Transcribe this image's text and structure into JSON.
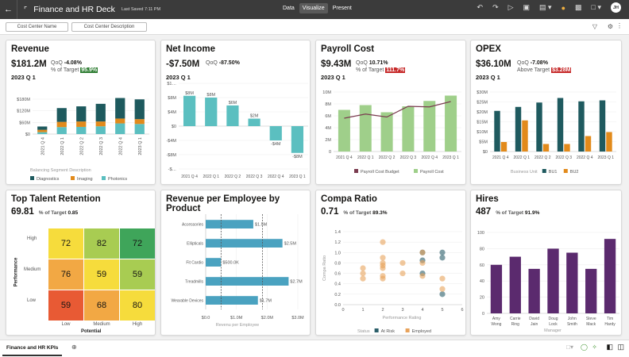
{
  "app": {
    "title": "Finance and HR Deck",
    "last_saved": "Last Saved 7:11 PM",
    "modes": [
      "Data",
      "Visualize",
      "Present"
    ],
    "active_mode": "Visualize",
    "avatar": "JH"
  },
  "filters": [
    "Cost Center Name",
    "Cost Center Description"
  ],
  "tabs": {
    "active": "Finance and HR KPIs"
  },
  "colors": {
    "diagnostics": "#1e5a5e",
    "imaging": "#e28a1b",
    "photonics": "#5bbfc0",
    "net_income": "#5bbfc0",
    "payroll": "#9fcf8a",
    "budget": "#7a3b4f",
    "bu1": "#1f5a5f",
    "bu2": "#e28a1b",
    "rev_emp": "#4aa2c0",
    "hires": "#5b2a6e",
    "at_risk": "#2c5f6a",
    "employed": "#e8a35c",
    "good": "#2e7d32",
    "bad": "#c62828"
  },
  "cards": {
    "revenue": {
      "title": "Revenue",
      "value": "$181.2M",
      "qoq_label": "QoQ",
      "qoq": "-4.08%",
      "target_label": "% of Target",
      "target": "95.9%",
      "period": "2023 Q 1"
    },
    "net_income": {
      "title": "Net Income",
      "value": "-$7.50M",
      "qoq_label": "QoQ",
      "qoq": "-87.50%",
      "period": "2023 Q 1"
    },
    "payroll": {
      "title": "Payroll Cost",
      "value": "$9.43M",
      "qoq_label": "QoQ",
      "qoq": "10.71%",
      "target_label": "% of Target",
      "target": "111.7%",
      "period": "2023 Q 1"
    },
    "opex": {
      "title": "OPEX",
      "value": "$36.10M",
      "qoq_label": "QoQ",
      "qoq": "-7.08%",
      "target_label": "Above Target",
      "target": "$3.28M",
      "period": "2023 Q 1"
    },
    "talent": {
      "title": "Top Talent Retention",
      "value": "69.81",
      "target_label": "% of Target",
      "target": "0.85"
    },
    "rev_emp": {
      "title": "Revenue per Employee by Product"
    },
    "compa": {
      "title": "Compa Ratio",
      "value": "0.71",
      "target_label": "% of Target",
      "target": "89.3%"
    },
    "hires": {
      "title": "Hires",
      "value": "487",
      "target_label": "% of Target",
      "target": "91.9%"
    }
  },
  "chart_data": [
    {
      "id": "revenue",
      "type": "bar",
      "stacked": true,
      "categories": [
        "2021 Q 4",
        "2022 Q 1",
        "2022 Q 2",
        "2022 Q 3",
        "2022 Q 4",
        "2023 Q 1"
      ],
      "series": [
        {
          "name": "Photonics",
          "values": [
            10,
            36,
            37,
            40,
            55,
            52
          ]
        },
        {
          "name": "Imaging",
          "values": [
            12,
            27,
            28,
            25,
            25,
            25
          ]
        },
        {
          "name": "Diagnostics",
          "values": [
            17,
            71,
            78,
            91,
            106,
            102
          ]
        }
      ],
      "ylim": [
        0,
        180
      ],
      "yticks": [
        "$0",
        "$60M",
        "$120M",
        "$180M"
      ],
      "legend_title": "Balancing Segment Description",
      "legend": "bottom"
    },
    {
      "id": "net_income",
      "type": "bar",
      "categories": [
        "2021 Q 4",
        "2022 Q 1",
        "2022 Q 2",
        "2022 Q 3",
        "2022 Q 4",
        "2023 Q 1"
      ],
      "values": [
        8.5,
        8,
        5.8,
        2.1,
        -4,
        -7.5
      ],
      "labels": [
        "$8M",
        "$8M",
        "$6M",
        "$2M",
        "-$4M",
        "-$8M"
      ],
      "ylim": [
        -12,
        12
      ],
      "yticks": [
        "-$…",
        "-$8M",
        "-$4M",
        "$0",
        "$4M",
        "$8M",
        "$1…"
      ]
    },
    {
      "id": "payroll",
      "type": "bar+line",
      "categories": [
        "2021 Q 4",
        "2022 Q 1",
        "2022 Q 2",
        "2022 Q 3",
        "2022 Q 4",
        "2023 Q 1"
      ],
      "series": [
        {
          "name": "Payroll Cost Budget",
          "type": "line",
          "values": [
            5.6,
            6.3,
            5.8,
            7.6,
            7.5,
            8.4
          ]
        },
        {
          "name": "Payroll Cost",
          "type": "bar",
          "values": [
            7,
            7.8,
            6.6,
            7.6,
            8.5,
            9.4
          ]
        }
      ],
      "ylim": [
        0,
        10
      ],
      "yticks": [
        "0",
        "2M",
        "4M",
        "6M",
        "8M",
        "10M"
      ],
      "legend": "bottom"
    },
    {
      "id": "opex",
      "type": "bar",
      "categories": [
        "2021 Q 4",
        "2022 Q 1",
        "2022 Q 2",
        "2022 Q 3",
        "2022 Q 4",
        "2023 Q 1"
      ],
      "series": [
        {
          "name": "BU1",
          "values": [
            20.5,
            22.5,
            24.7,
            27,
            25.3,
            25.8
          ]
        },
        {
          "name": "BU2",
          "values": [
            4.8,
            15.7,
            3.8,
            3.8,
            7.8,
            9.8
          ]
        }
      ],
      "ylim": [
        0,
        30
      ],
      "yticks": [
        "$0",
        "$5M",
        "$10M",
        "$15M",
        "$20M",
        "$25M",
        "$30M"
      ],
      "legend_title": "Business Unit",
      "legend": "bottom"
    },
    {
      "id": "talent",
      "type": "heatmap",
      "rows": [
        "High",
        "Medium",
        "Low"
      ],
      "cols": [
        "Low",
        "Medium",
        "High"
      ],
      "values": [
        [
          72,
          82,
          72
        ],
        [
          76,
          59,
          59
        ],
        [
          59,
          68,
          80
        ]
      ],
      "colors": [
        [
          "#f6dc3c",
          "#a8cc52",
          "#3fa55a"
        ],
        [
          "#f2a844",
          "#f6dc3c",
          "#a8cc52"
        ],
        [
          "#e85a34",
          "#f2a844",
          "#f6dc3c"
        ]
      ],
      "ylabel": "Performance",
      "xlabel": "Potential"
    },
    {
      "id": "rev_emp",
      "type": "bar",
      "orientation": "horizontal",
      "categories": [
        "Accessories",
        "Ellipticals",
        "Fit Cardio",
        "Treadmills",
        "Wearable Devices"
      ],
      "values": [
        1.55,
        2.5,
        0.5,
        2.7,
        1.7
      ],
      "labels": [
        "$1.5M",
        "$2.5M",
        "$500.0K",
        "$2.7M",
        "$1.7M"
      ],
      "reference_lines": [
        0.5,
        1.85
      ],
      "xlim": [
        0,
        3
      ],
      "xticks": [
        "$0.0",
        "$1.0M",
        "$2.0M",
        "$3.0M"
      ],
      "xlabel": "Revenu per Employee"
    },
    {
      "id": "compa",
      "type": "scatter",
      "xlim": [
        0,
        6
      ],
      "ylim": [
        0,
        1.4
      ],
      "xticks": [
        "0",
        "1",
        "2",
        "3",
        "4",
        "5",
        "6"
      ],
      "yticks": [
        "0.0",
        "0.2",
        "0.4",
        "0.6",
        "0.8",
        "1.0",
        "1.2",
        "1.4"
      ],
      "xlabel": "Performance Rating",
      "ylabel": "Compa Ratio",
      "legend_title": "Status",
      "series": [
        {
          "name": "At Risk",
          "points": [
            [
              4,
              1.0
            ],
            [
              4,
              0.85
            ],
            [
              4,
              0.6
            ],
            [
              5,
              1.0
            ],
            [
              5,
              0.9
            ],
            [
              5,
              0.2
            ]
          ]
        },
        {
          "name": "Employed",
          "points": [
            [
              1,
              0.7
            ],
            [
              1,
              0.6
            ],
            [
              1,
              0.5
            ],
            [
              2,
              1.2
            ],
            [
              2,
              0.9
            ],
            [
              2,
              0.8
            ],
            [
              2,
              0.75
            ],
            [
              2,
              0.7
            ],
            [
              2,
              0.55
            ],
            [
              2,
              0.5
            ],
            [
              3,
              0.8
            ],
            [
              3,
              0.6
            ],
            [
              4,
              1.0
            ],
            [
              4,
              0.8
            ],
            [
              4,
              0.55
            ],
            [
              5,
              0.5
            ],
            [
              5,
              0.3
            ]
          ]
        }
      ]
    },
    {
      "id": "hires",
      "type": "bar",
      "categories": [
        "Amy Wong",
        "Carrie Ring",
        "David Jain",
        "Doug Lock",
        "John Smith",
        "Steve Mack",
        "Tim Hardy"
      ],
      "values": [
        60,
        70,
        55,
        80,
        75,
        55,
        92
      ],
      "ylim": [
        0,
        100
      ],
      "yticks": [
        "0",
        "20",
        "40",
        "60",
        "80",
        "100"
      ],
      "xlabel": "Manager"
    }
  ]
}
